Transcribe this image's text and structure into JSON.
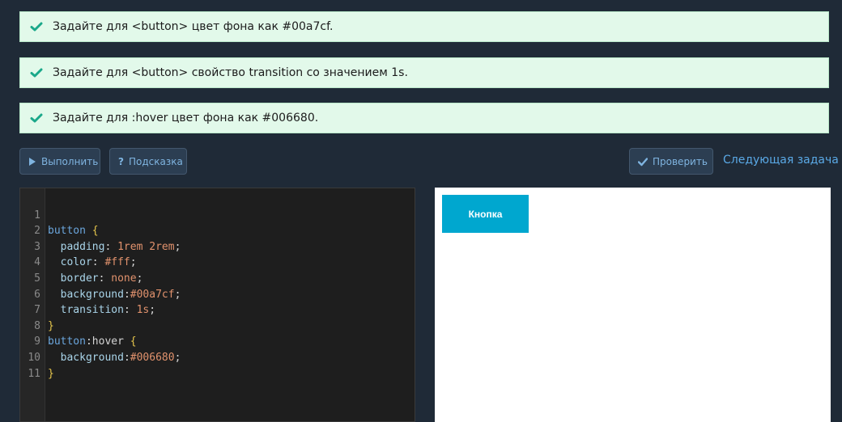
{
  "tasks": [
    {
      "text": "Задайте для <button> цвет фона как #00a7cf."
    },
    {
      "text": "Задайте для <button> свойство transition со значением 1s."
    },
    {
      "text": "Задайте для :hover цвет фона как #006680."
    }
  ],
  "toolbar": {
    "run_label": "Выполнить",
    "hint_label": "Подсказка",
    "check_label": "Проверить",
    "next_label": "Следующая задача"
  },
  "editor": {
    "line_numbers": [
      "1",
      "2",
      "3",
      "4",
      "5",
      "6",
      "7",
      "8",
      "9",
      "10",
      "11"
    ],
    "l1": {
      "sel": "button",
      "brace": "{"
    },
    "l2": {
      "prop": "padding",
      "val": "1rem 2rem"
    },
    "l3": {
      "prop": "color",
      "val": "#fff"
    },
    "l4": {
      "prop": "border",
      "val": "none"
    },
    "l5": {
      "prop": "background",
      "val": "#00a7cf"
    },
    "l6": {
      "prop": "transition",
      "val": "1s"
    },
    "l7": {
      "brace": "}"
    },
    "l8": {
      "sel": "button",
      "pseudo": ":hover",
      "brace": "{"
    },
    "l9": {
      "prop": "background",
      "val": "#006680"
    },
    "l10": {
      "brace": "}"
    }
  },
  "preview": {
    "button_label": "Кнопка"
  },
  "colors": {
    "task_bg": "#e2f9ea",
    "check": "#1aa88a",
    "preview_button": "#00a7cf"
  }
}
